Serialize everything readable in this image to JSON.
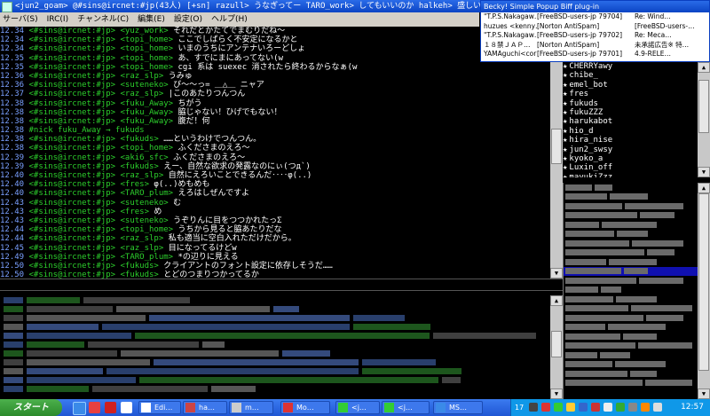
{
  "window": {
    "title": "<jun2_goam> @#sins@ircnet:#jp(43人) [+sn] razull> うなぎってー TARO_work> してもいいのか halkeh> 盛しい topi_home"
  },
  "menu": [
    "サーバ(S)",
    "IRC(I)",
    "チャンネル(C)",
    "編集(E)",
    "設定(O)",
    "ヘルプ(H)"
  ],
  "log": [
    {
      "time": "12.34",
      "nick": "<#sins@ircnet:#jp>",
      "from": "<yuz_work>",
      "text": "それだとかたてでまむりだね〜"
    },
    {
      "time": "12.34",
      "nick": "<#sins@ircnet:#jp>",
      "from": "<topi_home>",
      "text": "ここでしばらく不安定になるかと"
    },
    {
      "time": "12.34",
      "nick": "<#sins@ircnet:#jp>",
      "from": "<topi_home>",
      "text": "いまのうちにアンテナいろーどしょ"
    },
    {
      "time": "12.35",
      "nick": "<#sins@ircnet:#jp>",
      "from": "<topi_home>",
      "text": "あ、すでにまにあってない(w"
    },
    {
      "time": "12.35",
      "nick": "<#sins@ircnet:#jp>",
      "from": "<topi_home>",
      "text": "cgi 系は suexec 消されたら終わるからなぁ(w"
    },
    {
      "time": "12.36",
      "nick": "<#sins@ircnet:#jp>",
      "from": "<raz_slp>",
      "text": "うみゅ"
    },
    {
      "time": "12.36",
      "nick": "<#sins@ircnet:#jp>",
      "from": "<suteneko>",
      "text": "ぴ〜〜っ=  ＿△＿ ニャア"
    },
    {
      "time": "12.37",
      "nick": "<#sins@ircnet:#jp>",
      "from": "<raz_slp>",
      "text": "|このあたりつんつん"
    },
    {
      "time": "12.38",
      "nick": "<#sins@ircnet:#jp>",
      "from": "<fuku_Away>",
      "text": "ちがう"
    },
    {
      "time": "12.38",
      "nick": "<#sins@ircnet:#jp>",
      "from": "<fuku_Away>",
      "text": "脇じゃない！ひげでもない！"
    },
    {
      "time": "12.38",
      "nick": "<#sins@ircnet:#jp>",
      "from": "<fuku_Away>",
      "text": "腹だ！何"
    },
    {
      "time": "12.38",
      "nick": "",
      "from": "",
      "text": "#nick fuku_Away → fukuds",
      "sys": true
    },
    {
      "time": "12.38",
      "nick": "<#sins@ircnet:#jp>",
      "from": "<fukuds>",
      "text": "……というわけでつんつん。"
    },
    {
      "time": "12.38",
      "nick": "<#sins@ircnet:#jp>",
      "from": "<topi_home>",
      "text": "ふくださまのえろ〜"
    },
    {
      "time": "12.39",
      "nick": "<#sins@ircnet:#jp>",
      "from": "<aki6_sfc>",
      "text": "ふくださまのえろ〜"
    },
    {
      "time": "12.39",
      "nick": "<#sins@ircnet:#jp>",
      "from": "<fukuds>",
      "text": "えー、自然な欲求の発露なのにぃ(つд`)"
    },
    {
      "time": "12.40",
      "nick": "<#sins@ircnet:#jp>",
      "from": "<raz_slp>",
      "text": "自然にえろいことできるんだ‥‥φ(..)"
    },
    {
      "time": "12.40",
      "nick": "<#sins@ircnet:#jp>",
      "from": "<fres>",
      "text": "φ(..)めもめも"
    },
    {
      "time": "12.40",
      "nick": "<#sins@ircnet:#jp>",
      "from": "<TARO_plum>",
      "text": "えろはしぜんですよ"
    },
    {
      "time": "12.43",
      "nick": "<#sins@ircnet:#jp>",
      "from": "<suteneko>",
      "text": "む"
    },
    {
      "time": "12.43",
      "nick": "<#sins@ircnet:#jp>",
      "from": "<fres>",
      "text": "め"
    },
    {
      "time": "12.43",
      "nick": "<#sins@ircnet:#jp>",
      "from": "<suteneko>",
      "text": "うぞりんに目をつつかれたっΣ"
    },
    {
      "time": "12.44",
      "nick": "<#sins@ircnet:#jp>",
      "from": "<topi_home>",
      "text": "うちから見ると脇あたりだな"
    },
    {
      "time": "12.44",
      "nick": "<#sins@ircnet:#jp>",
      "from": "<raz_slp>",
      "text": "私も適当に空白入れただけだから。"
    },
    {
      "time": "12.45",
      "nick": "<#sins@ircnet:#jp>",
      "from": "<raz_slp>",
      "text": "目になってるけどw"
    },
    {
      "time": "12.49",
      "nick": "<#sins@ircnet:#jp>",
      "from": "<TARO_plum>",
      "text": "*の辺りに見える"
    },
    {
      "time": "12.50",
      "nick": "<#sins@ircnet:#jp>",
      "from": "<fukuds>",
      "text": "クライアントのフォント設定に依存しそうだ……"
    },
    {
      "time": "12.50",
      "nick": "<#sins@ircnet:#jp>",
      "from": "<fukuds>",
      "text": "とどのつまりつかってるか"
    }
  ],
  "input": {
    "value": ""
  },
  "popup": {
    "title": "Becky! Simple Popup Biff plug-in",
    "rows": [
      {
        "from": "\"T.P.S.Nakagaw…",
        "list": "[FreeBSD-users-jp 79704]",
        "subj": "Re: Wind…"
      },
      {
        "from": "huzues <kenny…",
        "list": "[Norton AntiSpam]",
        "subj": "[FreeBSD-users-…"
      },
      {
        "from": "\"T.P.S.Nakagaw…",
        "list": "[FreeBSD-users-jp 79702]",
        "subj": "Re: Meca…"
      },
      {
        "from": "１８禁ＪＡＰ…",
        "list": "[Norton AntiSpam]",
        "subj": "未承諾広告※ 特…"
      },
      {
        "from": "YAMAguchi<cor…",
        "list": "[FreeBSD-users-jp 79701]",
        "subj": "4.9-RELE…"
      }
    ]
  },
  "nicks": [
    "CHERRYawy",
    "chibe_",
    "emel_bot",
    "fres",
    "fukuds",
    "fukuZZZ",
    "harukabot",
    "hio_d",
    "hira_nise",
    "jun2_swsy",
    "kyoko_a",
    "Luxin_off",
    "mayukiZzz"
  ],
  "taskbar": {
    "start": "スタート",
    "buttons": [
      "Edi…",
      "ha…",
      "m…",
      "Mo…",
      "<j…",
      "<j…",
      "MS…"
    ],
    "clock": "12:57",
    "tray_number": "17"
  },
  "colors": {
    "timestamp": "#7aa0ff",
    "nick": "#2ccf2c",
    "text": "#ffffff",
    "selection": "#1010b0"
  }
}
